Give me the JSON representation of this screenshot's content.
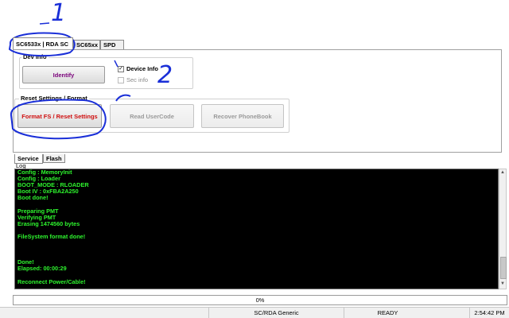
{
  "tabs": [
    "SC6533x | RDA SC",
    "SC65xx",
    "SPD FP"
  ],
  "dev_info": {
    "group_label": "Dev Info",
    "identify_button": "Identify",
    "device_info_checkbox": "Device Info",
    "device_info_checked": true,
    "sec_info_checkbox": "Sec info",
    "sec_info_checked": false
  },
  "reset": {
    "group_label": "Reset Settings / Format",
    "format_button": "Format FS / Reset Settings",
    "read_usercode_button": "Read UserCode",
    "recover_phonebook_button": "Recover PhoneBook"
  },
  "bottom_tabs": [
    "Service",
    "Flash"
  ],
  "log": {
    "label": "Log",
    "lines": [
      "Config : MemoryInit",
      "Config : Loader",
      "BOOT_MODE : RLOADER",
      "Boot IV : 0xFBA2A250",
      "Boot done!",
      "",
      "Preparing PMT",
      "Verifying PMT",
      "Erasing 1474560 bytes",
      "",
      "FileSystem format done!",
      "",
      "",
      "",
      "Done!",
      "Elapsed: 00:00:29",
      "",
      "Reconnect Power/Cable!"
    ]
  },
  "progress": {
    "text": "0%",
    "value": 0
  },
  "status": {
    "model": "SC/RDA Generic",
    "state": "READY",
    "time": "2:54:42 PM"
  },
  "annotations": [
    "1",
    "2"
  ],
  "colors": {
    "format_button_text": "#d01010",
    "identify_button_text": "#7a007a",
    "log_text": "#2ef52e",
    "annotation_ink": "#1a2fd8"
  }
}
